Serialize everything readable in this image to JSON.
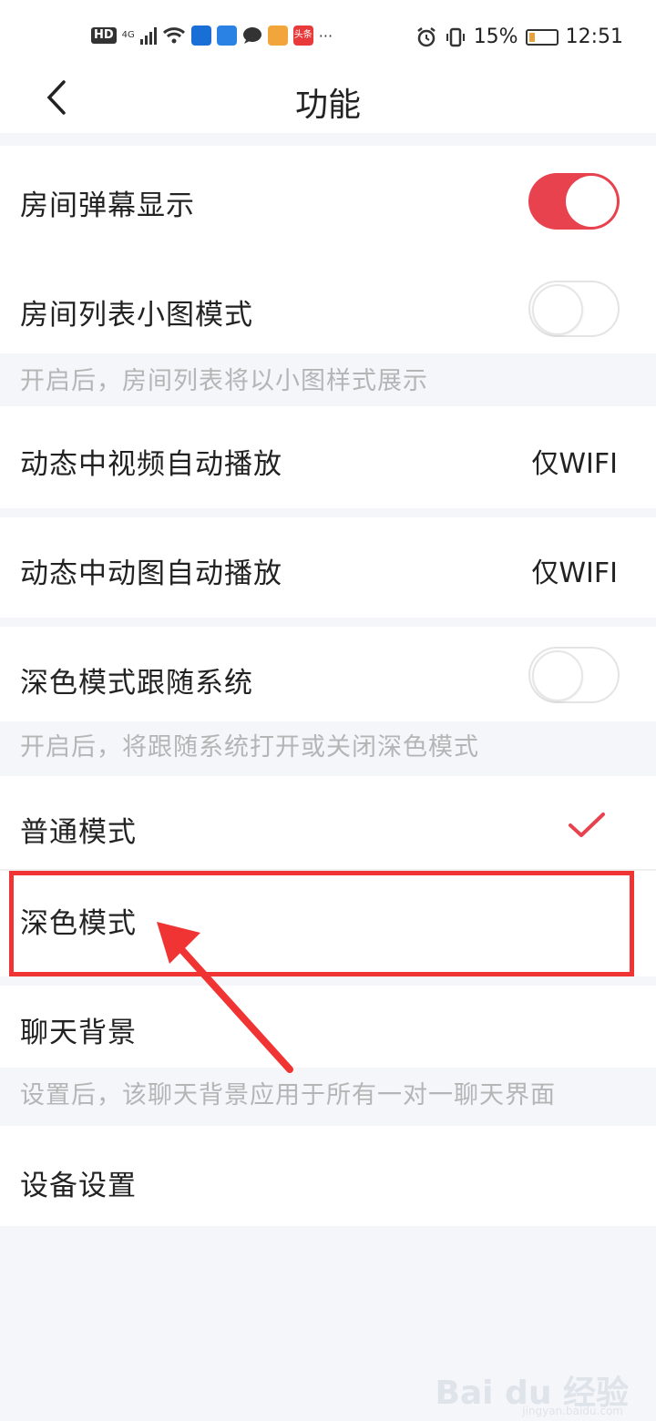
{
  "status_bar": {
    "badge": "HD",
    "network": "4G",
    "app_badge_label": "头条",
    "more": "···",
    "battery": "15%",
    "time": "12:51"
  },
  "nav": {
    "back_icon": "chevron-left-icon",
    "title": "功能"
  },
  "settings": [
    {
      "label": "房间弹幕显示",
      "control": "toggle",
      "on": true
    },
    {
      "label": "房间列表小图模式",
      "control": "toggle",
      "on": false,
      "hint": "开启后，房间列表将以小图样式展示"
    },
    {
      "label": "动态中视频自动播放",
      "control": "value",
      "value": "仅WIFI"
    },
    {
      "label": "动态中动图自动播放",
      "control": "value",
      "value": "仅WIFI"
    },
    {
      "label": "深色模式跟随系统",
      "control": "toggle",
      "on": false,
      "hint": "开启后，将跟随系统打开或关闭深色模式"
    },
    {
      "label": "普通模式",
      "control": "check",
      "checked": true
    },
    {
      "label": "深色模式",
      "control": "none"
    },
    {
      "label": "聊天背景",
      "control": "none",
      "hint": "设置后，该聊天背景应用于所有一对一聊天界面"
    },
    {
      "label": "设备设置",
      "control": "none"
    }
  ],
  "colors": {
    "accent": "#e8424f",
    "annotation": "#f03434",
    "hint_text": "#b5b5b5"
  },
  "watermark": {
    "logo": "Bai du 经验",
    "url": "jingyan.baidu.com"
  }
}
